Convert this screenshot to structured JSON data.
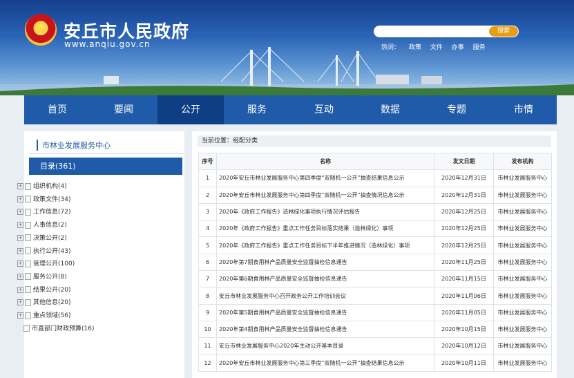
{
  "header": {
    "title": "安丘市人民政府",
    "url": "www.anqiu.gov.cn",
    "search_button": "搜索",
    "hot_label": "热词：",
    "hot_words": [
      "政策",
      "文件",
      "办事",
      "服务"
    ]
  },
  "nav": [
    "首页",
    "要闻",
    "公开",
    "服务",
    "互动",
    "数据",
    "专题",
    "市情"
  ],
  "nav_active_index": 2,
  "sidebar": {
    "title": "市林业发展服务中心",
    "directory": "目录(361)",
    "items": [
      "组织机构(4)",
      "政策文件(34)",
      "工作信息(72)",
      "人事信息(2)",
      "决策公开(2)",
      "执行公开(43)",
      "管理公开(100)",
      "服务公开(8)",
      "结果公开(20)",
      "其他信息(20)",
      "重点领域(56)"
    ],
    "sub_item": "市直部门财政预算(16)"
  },
  "main": {
    "breadcrumb": "当前位置：组配分类",
    "columns": [
      "序号",
      "名称",
      "发文日期",
      "发布机构"
    ],
    "rows": [
      [
        "1",
        "2020年安丘市林业发展服务中心第四季度“双随机一公开”抽查结果信息公示",
        "2020年12月31日",
        "市林业发展服务中心"
      ],
      [
        "2",
        "2020年安丘市林业发展服务中心第四季度“双随机一公开”抽查情况信息公示",
        "2020年12月31日",
        "市林业发展服务中心"
      ],
      [
        "3",
        "2020年《政府工作报告》造林绿化事项执行情况评估报告",
        "2020年12月25日",
        "市林业发展服务中心"
      ],
      [
        "4",
        "2020年《政府工作报告》重点工作任务目标落实结果（造林绿化）事项",
        "2020年12月25日",
        "市林业发展服务中心"
      ],
      [
        "5",
        "2020年《政府工作报告》重点工作任务目标下半年推进情况（造林绿化）事项",
        "2020年12月25日",
        "市林业发展服务中心"
      ],
      [
        "6",
        "2020年第7期食用林产品质量安全监督抽检信息通告",
        "2020年11月25日",
        "市林业发展服务中心"
      ],
      [
        "7",
        "2020年第6期食用林产品质量安全监督抽检信息通告",
        "2020年11月15日",
        "市林业发展服务中心"
      ],
      [
        "8",
        "安丘市林业发展服务中心召开政务公开工作培训会议",
        "2020年11月06日",
        "市林业发展服务中心"
      ],
      [
        "9",
        "2020年第5期食用林产品质量安全监督抽检信息通告",
        "2020年11月05日",
        "市林业发展服务中心"
      ],
      [
        "10",
        "2020年第4期食用林产品质量安全监督抽检信息通告",
        "2020年10月15日",
        "市林业发展服务中心"
      ],
      [
        "11",
        "安丘市林业发展服务中心2020年主动公开基本目录",
        "2020年10月12日",
        "市林业发展服务中心"
      ],
      [
        "12",
        "2020年安丘市林业发展服务中心第三季度“双随机一公开”抽查结果信息公示",
        "2020年10月11日",
        "市林业发展服务中心"
      ]
    ]
  },
  "colors": {
    "nav_bg": "#1f5ba8",
    "nav_active": "#0e3e84",
    "search_button": "#e89c14",
    "page_bg": "#e9eef4"
  }
}
